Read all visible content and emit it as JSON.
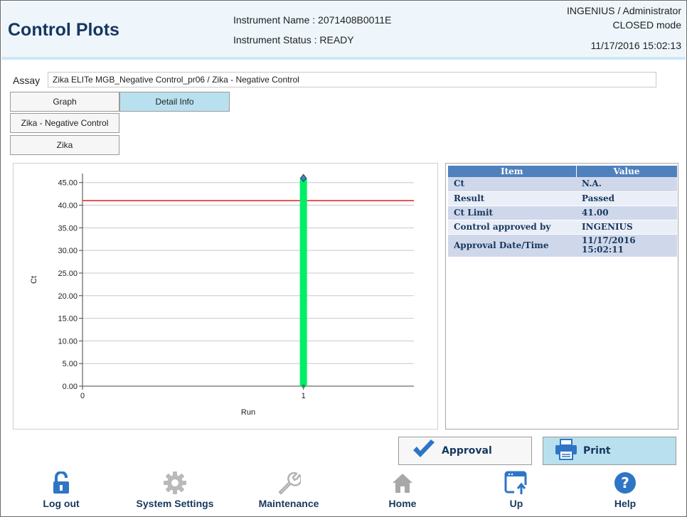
{
  "header": {
    "title": "Control Plots",
    "instrument_name": "Instrument Name :  2071408B0011E",
    "instrument_status": "Instrument Status : READY",
    "user": "INGENIUS / Administrator",
    "mode": "CLOSED mode",
    "datetime": "11/17/2016 15:02:13"
  },
  "assay": {
    "label": "Assay",
    "value": "Zika ELITe MGB_Negative Control_pr06 / Zika - Negative Control"
  },
  "tabs": [
    {
      "label": "Graph",
      "active": false
    },
    {
      "label": "Detail Info",
      "active": true
    }
  ],
  "control_list": [
    "Zika - Negative Control",
    "Zika"
  ],
  "chart_data": {
    "type": "bar",
    "x": [
      1
    ],
    "values": [
      46.0
    ],
    "xlabel": "Run",
    "ylabel": "Ct",
    "xlim": [
      0,
      1.5
    ],
    "ylim": [
      0,
      47
    ],
    "y_ticks": [
      "0.00",
      "5.00",
      "10.00",
      "15.00",
      "20.00",
      "25.00",
      "30.00",
      "35.00",
      "40.00",
      "45.00"
    ],
    "y_tick_values": [
      0,
      5,
      10,
      15,
      20,
      25,
      30,
      35,
      40,
      45
    ],
    "x_ticks": [
      "0",
      "1"
    ],
    "x_tick_values": [
      0,
      1
    ],
    "limit_line": 41.0,
    "grid": true,
    "bar_color": "#00ee66",
    "marker_color": "#4f81bd",
    "limit_color": "#e81a1a"
  },
  "detail": {
    "headers": [
      "Item",
      "Value"
    ],
    "rows": [
      {
        "item": "Ct",
        "value": "N.A."
      },
      {
        "item": "Result",
        "value": "Passed"
      },
      {
        "item": "Ct Limit",
        "value": "41.00"
      },
      {
        "item": "Control approved by",
        "value": "INGENIUS"
      },
      {
        "item": "Approval Date/Time",
        "value": "11/17/2016 15:02:11"
      }
    ]
  },
  "actions": {
    "approval": "Approval",
    "print": "Print"
  },
  "nav": [
    {
      "label": "Log out",
      "icon": "unlock-icon"
    },
    {
      "label": "System Settings",
      "icon": "gear-icon"
    },
    {
      "label": "Maintenance",
      "icon": "wrench-icon"
    },
    {
      "label": "Home",
      "icon": "home-icon"
    },
    {
      "label": "Up",
      "icon": "window-up-icon"
    },
    {
      "label": "Help",
      "icon": "help-icon"
    }
  ],
  "colors": {
    "title": "#17375e",
    "header_bg": "#eef6fc",
    "active_tab": "#b9e0ee",
    "table_header": "#4f81bd",
    "print_button": "#b9e0ee"
  }
}
